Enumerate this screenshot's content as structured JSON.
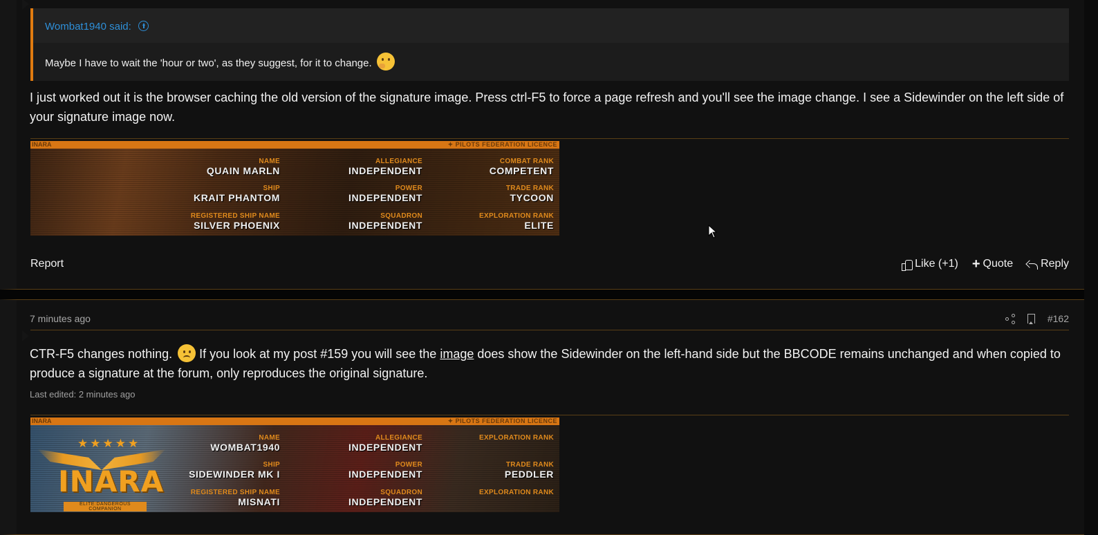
{
  "post_a": {
    "quote": {
      "author": "Wombat1940 said:",
      "text": "Maybe I have to wait the 'hour or two', as they suggest, for it to change."
    },
    "message": "I just worked out it is the browser caching the old version of the signature image. Press ctrl-F5 to force a page refresh and you'll see the image change. I see a Sidewinder on the left side of your signature image now.",
    "signature": {
      "strip_left": "INARA",
      "strip_right": "PILOTS FEDERATION LICENCE",
      "fields": {
        "name_label": "NAME",
        "name": "QUAIN MARLN",
        "allegiance_label": "ALLEGIANCE",
        "allegiance": "INDEPENDENT",
        "combat_label": "COMBAT RANK",
        "combat": "COMPETENT",
        "ship_label": "SHIP",
        "ship": "KRAIT PHANTOM",
        "power_label": "POWER",
        "power": "INDEPENDENT",
        "trade_label": "TRADE RANK",
        "trade": "TYCOON",
        "shipname_label": "REGISTERED SHIP NAME",
        "shipname": "SILVER PHOENIX",
        "squadron_label": "SQUADRON",
        "squadron": "INDEPENDENT",
        "explore_label": "EXPLORATION RANK",
        "explore": "ELITE"
      }
    },
    "footer": {
      "report": "Report",
      "like": "Like (+1)",
      "quote": "Quote",
      "reply": "Reply"
    }
  },
  "post_b": {
    "time": "7 minutes ago",
    "number": "#162",
    "message_part1": "CTR-F5 changes nothing.",
    "message_part2": " If you look at my post #159 you will see the ",
    "message_link": "image",
    "message_part3": " does show the Sidewinder on the left-hand side but the BBCODE remains unchanged and when copied to produce a signature at the forum, only reproduces the original signature.",
    "edited": "Last edited: 2 minutes ago",
    "signature": {
      "strip_left": "INARA",
      "strip_right": "PILOTS FEDERATION LICENCE",
      "logo_text": "INARA",
      "logo_tag": "ELITE:DANGEROUS COMPANION",
      "fields": {
        "name_label": "NAME",
        "name": "WOMBAT1940",
        "allegiance_label": "ALLEGIANCE",
        "allegiance": "INDEPENDENT",
        "combat_label": "EXPLORATION RANK",
        "combat": "",
        "ship_label": "SHIP",
        "ship": "SIDEWINDER MK I",
        "power_label": "POWER",
        "power": "INDEPENDENT",
        "trade_label": "TRADE RANK",
        "trade": "PEDDLER",
        "shipname_label": "REGISTERED SHIP NAME",
        "shipname": "MISNATI",
        "squadron_label": "SQUADRON",
        "squadron": "INDEPENDENT",
        "explore_label": "EXPLORATION RANK",
        "explore": ""
      }
    }
  },
  "colors": {
    "accent": "#e07b10",
    "link": "#2e8fd8",
    "background": "#111111"
  }
}
